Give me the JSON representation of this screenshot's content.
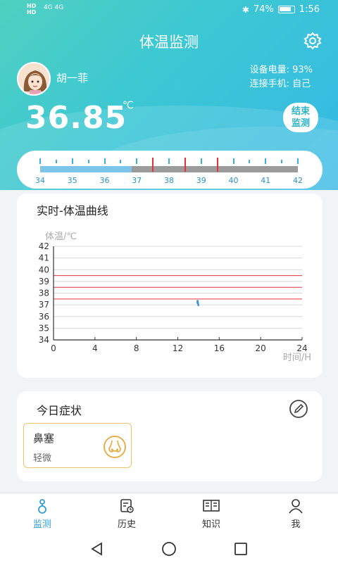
{
  "status_bar": {
    "left_lines": [
      "HD",
      "HD"
    ],
    "signal": "4G 4G",
    "battery_pct": "74%",
    "time": "1:56"
  },
  "header": {
    "title": "体温监测",
    "settings_icon": "gear-icon"
  },
  "user": {
    "name": "胡一菲",
    "device_battery": "设备电量: 93%",
    "connected_phone": "连接手机: 自己"
  },
  "reading": {
    "temperature": "36.85",
    "unit": "℃",
    "end_button": [
      "结束",
      "监测"
    ]
  },
  "scale": {
    "labels": [
      "34",
      "35",
      "36",
      "37",
      "38",
      "39",
      "40",
      "41",
      "42"
    ],
    "current_value": 36.85,
    "red_marks": [
      37.5,
      38.5,
      39.5
    ],
    "colors": {
      "fill": "#7cc4e9",
      "track": "#9b9b9b",
      "mark": "#e4323a",
      "label": "#2a93c8"
    }
  },
  "chart_card": {
    "title": "实时-体温曲线"
  },
  "chart_data": {
    "type": "line",
    "ylabel": "体温/℃",
    "xlabel": "时间/H",
    "x_ticks": [
      0,
      4,
      8,
      12,
      16,
      20,
      24
    ],
    "y_ticks": [
      34,
      35,
      36,
      37,
      38,
      39,
      40,
      41,
      42
    ],
    "xlim": [
      0,
      24
    ],
    "ylim": [
      34,
      42
    ],
    "reference_lines": [
      37.5,
      38.5,
      39.5
    ],
    "reference_color": "#e4323a",
    "series": [
      {
        "values": [
          [
            13.9,
            37.1
          ],
          [
            13.9,
            37.4
          ],
          [
            14.0,
            36.9
          ]
        ],
        "color": "#3a8fd6"
      }
    ],
    "grid": true
  },
  "symptoms": {
    "title": "今日症状",
    "edit_icon": "edit-icon",
    "items": [
      {
        "name": "鼻塞",
        "level": "轻微",
        "icon": "nose-icon"
      }
    ]
  },
  "bottom_nav": [
    {
      "label": "监测",
      "icon": "thermometer-icon",
      "active": true
    },
    {
      "label": "历史",
      "icon": "history-icon",
      "active": false
    },
    {
      "label": "知识",
      "icon": "book-icon",
      "active": false
    },
    {
      "label": "我",
      "icon": "person-icon",
      "active": false
    }
  ]
}
